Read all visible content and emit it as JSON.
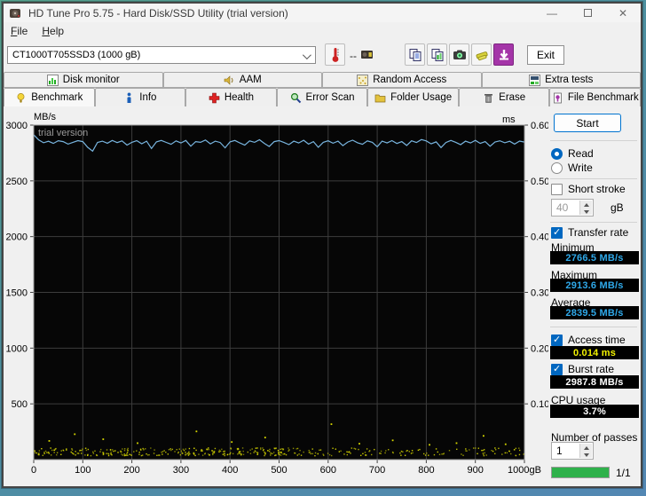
{
  "window": {
    "title": "HD Tune Pro 5.75 - Hard Disk/SSD Utility (trial version)"
  },
  "menu": {
    "file": "File",
    "help": "Help"
  },
  "toolbar": {
    "drive_selected": "CT1000T705SSD3 (1000 gB)",
    "temperature": "--",
    "exit_label": "Exit",
    "icons": [
      "thermometer-icon",
      "disk-temp-icon",
      "copy-text-icon",
      "copy-image-icon",
      "screenshot-camera-icon",
      "highlight-icon",
      "save-results-icon"
    ]
  },
  "tabs": {
    "row1": [
      {
        "label": "Disk monitor"
      },
      {
        "label": "AAM"
      },
      {
        "label": "Random Access"
      },
      {
        "label": "Extra tests"
      }
    ],
    "row2": [
      {
        "label": "Benchmark",
        "active": true
      },
      {
        "label": "Info"
      },
      {
        "label": "Health"
      },
      {
        "label": "Error Scan"
      },
      {
        "label": "Folder Usage"
      },
      {
        "label": "Erase"
      },
      {
        "label": "File Benchmark"
      }
    ]
  },
  "panel": {
    "start_label": "Start",
    "read_label": "Read",
    "write_label": "Write",
    "short_stroke_label": "Short stroke",
    "short_stroke_value": "40",
    "short_stroke_unit": "gB",
    "transfer_rate_label": "Transfer rate",
    "minimum_label": "Minimum",
    "minimum_value": "2766.5 MB/s",
    "maximum_label": "Maximum",
    "maximum_value": "2913.6 MB/s",
    "average_label": "Average",
    "average_value": "2839.5 MB/s",
    "access_time_label": "Access time",
    "access_time_value": "0.014 ms",
    "burst_rate_label": "Burst rate",
    "burst_rate_value": "2987.8 MB/s",
    "cpu_usage_label": "CPU usage",
    "cpu_usage_value": "3.7%",
    "passes_label": "Number of passes",
    "passes_value": "1",
    "progress_label": "1/1"
  },
  "chart_data": {
    "type": "line",
    "watermark": "trial version",
    "y_left": {
      "label": "MB/s",
      "min": 0,
      "max": 3000,
      "ticks": [
        3000,
        2500,
        2000,
        1500,
        1000,
        500
      ]
    },
    "y_right": {
      "label": "ms",
      "min": 0,
      "max": 0.6,
      "ticks": [
        "0.60",
        "0.50",
        "0.40",
        "0.30",
        "0.20",
        "0.10"
      ]
    },
    "x_axis": {
      "min": 0,
      "max": 1000,
      "ticks": [
        0,
        100,
        200,
        300,
        400,
        500,
        600,
        700,
        800,
        900
      ],
      "end_label": "1000gB"
    },
    "series": [
      {
        "name": "read-transfer-rate",
        "unit": "MB/s",
        "color": "#78b4de",
        "x_step": 10,
        "values": [
          2913.6,
          2868,
          2842,
          2855,
          2836,
          2860,
          2852,
          2830,
          2846,
          2861,
          2852,
          2801,
          2766.5,
          2845,
          2856,
          2838,
          2862,
          2843,
          2858,
          2821,
          2846,
          2861,
          2833,
          2856,
          2791,
          2850,
          2862,
          2845,
          2828,
          2858,
          2840,
          2862,
          2811,
          2852,
          2846,
          2866,
          2832,
          2856,
          2844,
          2796,
          2850,
          2862,
          2840,
          2820,
          2858,
          2846,
          2869,
          2836,
          2808,
          2852,
          2861,
          2844,
          2825,
          2856,
          2840,
          2864,
          2830,
          2852,
          2801,
          2846,
          2859,
          2838,
          2856,
          2816,
          2848,
          2865,
          2842,
          2828,
          2858,
          2846,
          2806,
          2856,
          2840,
          2861,
          2835,
          2852,
          2818,
          2859,
          2844,
          2870,
          2858,
          2832,
          2850,
          2799,
          2844,
          2862,
          2846,
          2825,
          2856,
          2840,
          2863,
          2836,
          2852,
          2811,
          2848,
          2859,
          2842,
          2855,
          2830,
          2857,
          2848
        ]
      },
      {
        "name": "access-time-scatter",
        "unit": "ms",
        "color": "#d6d600",
        "band_ms": [
          0.008,
          0.022
        ],
        "count": 520,
        "seed": 1234,
        "outliers": [
          [
            30,
            0.035
          ],
          [
            82,
            0.047
          ],
          [
            140,
            0.038
          ],
          [
            210,
            0.031
          ],
          [
            330,
            0.052
          ],
          [
            402,
            0.033
          ],
          [
            470,
            0.041
          ],
          [
            605,
            0.065
          ],
          [
            662,
            0.03
          ],
          [
            730,
            0.036
          ],
          [
            805,
            0.028
          ],
          [
            860,
            0.031
          ],
          [
            915,
            0.044
          ],
          [
            960,
            0.029
          ]
        ]
      }
    ],
    "summary": {
      "minimum_mbs": 2766.5,
      "maximum_mbs": 2913.6,
      "average_mbs": 2839.5,
      "access_time_ms": 0.014,
      "burst_rate_mbs": 2987.8,
      "cpu_usage_pct": 3.7
    },
    "style": {
      "plot_bg": "#060606",
      "grid": "#3d3d3d",
      "border": "#9a9a9a"
    }
  }
}
